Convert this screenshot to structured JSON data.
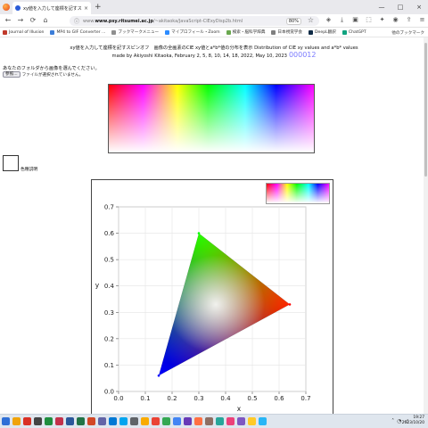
{
  "browser": {
    "tab_title": "xy値を入力して座標を記すスピンオフ",
    "tab_close": "×",
    "new_tab": "+",
    "url_host": "www.psy.ritsumei.ac.jp",
    "url_path": "/~akitaoka/JavaScript-CIExyDisp2b.html",
    "url_prefix": "www.",
    "zoom": "80%",
    "window_controls": [
      "—",
      "□",
      "×"
    ],
    "nav": {
      "back": "←",
      "forward": "→",
      "reload": "⟳",
      "home": "⌂"
    }
  },
  "bookmarks": [
    {
      "label": "Journal of Illusion",
      "color": "#c0392b"
    },
    {
      "label": "MP4 to GIF Converter ...",
      "color": "#3b7dd8"
    },
    {
      "label": "ブックマークメニュー",
      "color": "#8e8e8e"
    },
    {
      "label": "マイプロフィール・Zoom",
      "color": "#2d8cff"
    },
    {
      "label": "検索・脳科学辞典",
      "color": "#6aa84f"
    },
    {
      "label": "日本視覚学会",
      "color": "#7f7f7f"
    },
    {
      "label": "DeepL翻訳",
      "color": "#0f2b46"
    },
    {
      "label": "ChatGPT",
      "color": "#10a37f"
    }
  ],
  "bookmarks_other": "他のブックマーク",
  "page": {
    "title_line1": "xy値を入力して座標を記すスピンオフ　画像の全画素のCIE xy値とa*b*値の分布を表示 Distribution of CIE xy values and a*b* values",
    "title_line2": "made by Akiyoshi Kitaoka, February 2, 5, 8, 10, 14, 18, 2022, May 10, 2023",
    "counter": "000012",
    "prompt": "あなたのフォルダから画像を選んでください。",
    "file_button": "参照...",
    "file_status": "ファイルが選択されていません。",
    "color_label": "色種説明"
  },
  "chart_data": {
    "type": "scatter",
    "title": "",
    "xlabel": "x",
    "ylabel": "y",
    "xlim": [
      0.0,
      0.7
    ],
    "ylim": [
      0.0,
      0.7
    ],
    "x_ticks": [
      "0.0",
      "0.1",
      "0.2",
      "0.3",
      "0.4",
      "0.5",
      "0.6",
      "0.7"
    ],
    "y_ticks": [
      "0.0",
      "0.1",
      "0.2",
      "0.3",
      "0.4",
      "0.5",
      "0.6",
      "0.7"
    ],
    "grid": true,
    "series": [
      {
        "points": [
          {
            "x": 0.64,
            "y": 0.33,
            "color": "#ff0000"
          },
          {
            "x": 0.3,
            "y": 0.6,
            "color": "#00ff00"
          },
          {
            "x": 0.15,
            "y": 0.06,
            "color": "#0000ff"
          }
        ]
      }
    ],
    "fill": "gamut triangle filled with interpolated sRGB colors, white near center"
  },
  "taskbar": {
    "time": "19:27",
    "date": "2023/10/20",
    "apps": [
      "#2f6fd6",
      "#f0a30a",
      "#d93025",
      "#444444",
      "#1e8e3e",
      "#c4314b",
      "#2b579a",
      "#217346",
      "#d24726",
      "#6264a7",
      "#0078d4",
      "#00a4ef",
      "#5f6368",
      "#f9ab00",
      "#ea4335",
      "#34a853",
      "#4285f4",
      "#673ab7",
      "#ff7043",
      "#8d6e63",
      "#26a69a",
      "#ec407a",
      "#7e57c2",
      "#ffca28",
      "#29b6f6"
    ]
  }
}
